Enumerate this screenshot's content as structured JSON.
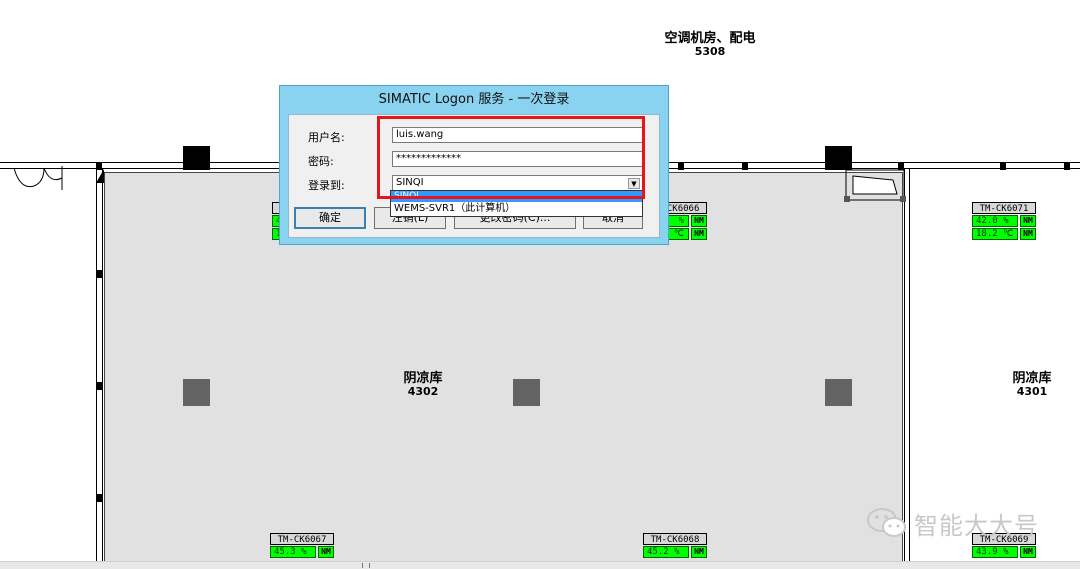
{
  "rooms": {
    "top": {
      "name": "空调机房、配电",
      "code": "5308"
    },
    "center": {
      "name": "阴凉库",
      "code": "4302"
    },
    "right": {
      "name": "阴凉库",
      "code": "4301"
    }
  },
  "sensors": [
    {
      "id": "",
      "line1": "4",
      "line2": "1",
      "status": ""
    },
    {
      "id": "TM-CK6066",
      "line1": "%",
      "line2": "℃",
      "status": "NM"
    },
    {
      "id": "TM-CK6071",
      "line1": "42.0 %",
      "line2": "18.2 ℃",
      "status": "NM"
    },
    {
      "id": "TM-CK6067",
      "line1": "45.3 %",
      "line2": "",
      "status": "NM"
    },
    {
      "id": "TM-CK6068",
      "line1": "45.2 %",
      "line2": "",
      "status": "NM"
    },
    {
      "id": "TM-CK6069",
      "line1": "43.9 %",
      "line2": "",
      "status": "NM"
    }
  ],
  "dialog": {
    "title": "SIMATIC Logon 服务 - 一次登录",
    "username_label": "用户名:",
    "username_value": "luis.wang",
    "password_label": "密码:",
    "password_value": "*************",
    "domain_label": "登录到:",
    "domain_value": "SINQI",
    "dropdown_options": [
      "SINQI",
      "WEMS-SVR1（此计算机）"
    ],
    "buttons": {
      "ok": "确定",
      "logoff": "注销(L)",
      "change_password": "更改密码(C)...",
      "cancel": "取消"
    }
  },
  "watermark": {
    "text": "智能大大号"
  },
  "colors": {
    "sensor_green": "#00ff00",
    "highlight_red": "#e8141c",
    "dialog_frame": "#8ad3f0",
    "selection_blue": "#3399ff"
  }
}
